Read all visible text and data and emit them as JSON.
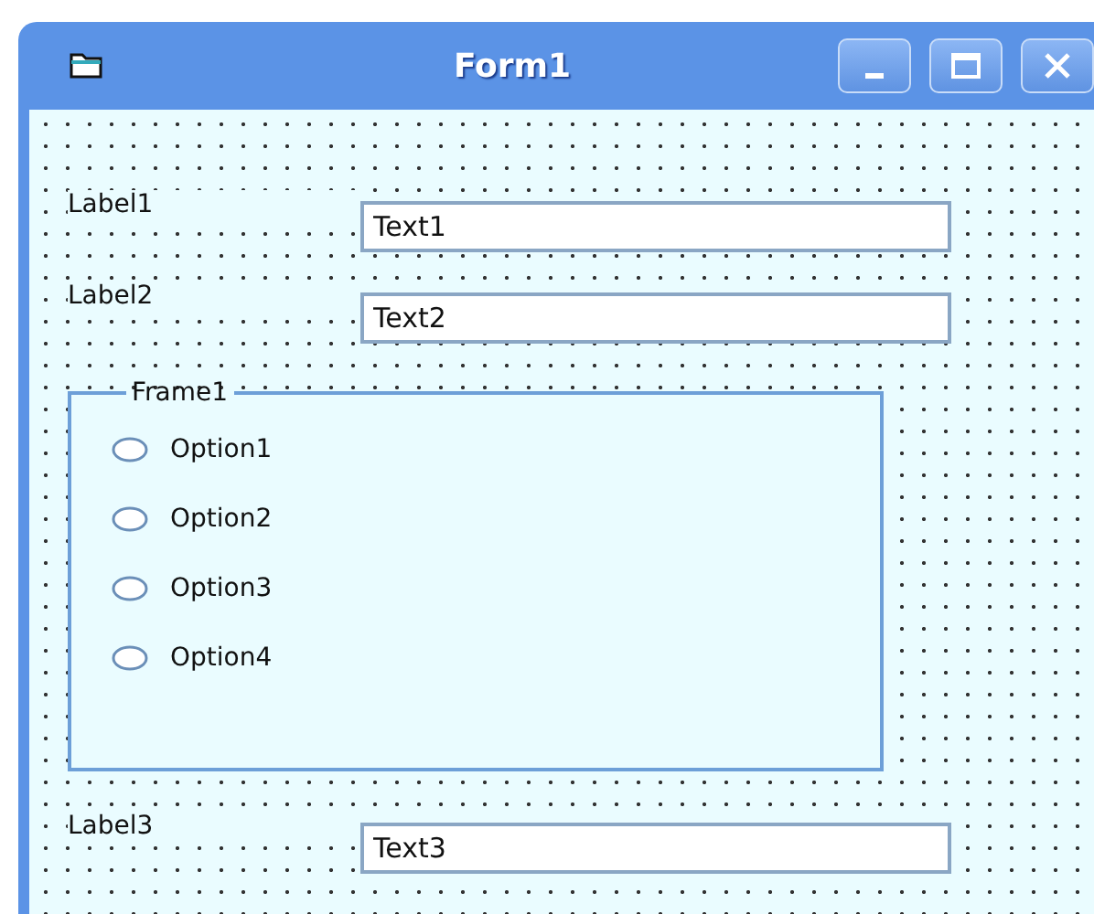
{
  "window": {
    "title": "Form1"
  },
  "controls": [
    {
      "kind": "field",
      "label": "Label1",
      "value": "Text1"
    },
    {
      "kind": "field",
      "label": "Label2",
      "value": "Text2"
    },
    {
      "kind": "frame",
      "caption": "Frame1",
      "options": [
        {
          "label": "Option1",
          "selected": false
        },
        {
          "label": "Option2",
          "selected": false
        },
        {
          "label": "Option3",
          "selected": false
        },
        {
          "label": "Option4",
          "selected": false
        }
      ]
    },
    {
      "kind": "field",
      "label": "Label3",
      "value": "Text3"
    }
  ]
}
